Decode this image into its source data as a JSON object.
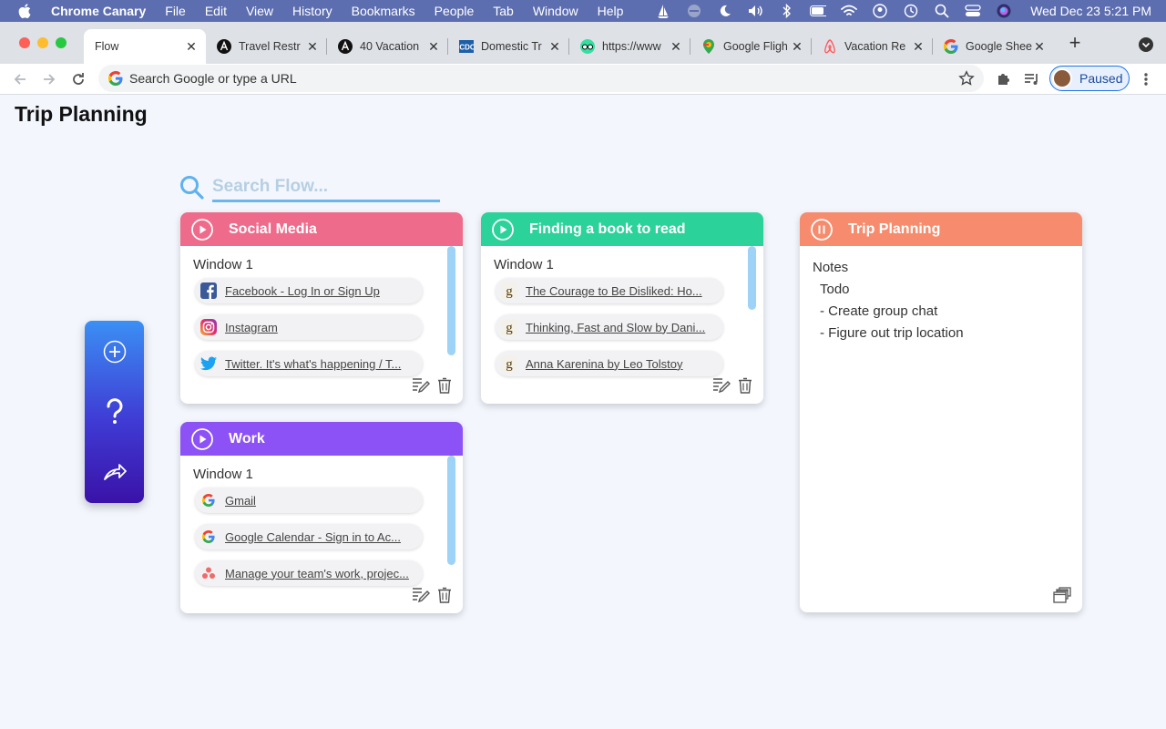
{
  "menubar": {
    "app_name": "Chrome Canary",
    "items": [
      "File",
      "Edit",
      "View",
      "History",
      "Bookmarks",
      "People",
      "Tab",
      "Window",
      "Help"
    ],
    "clock": "Wed Dec 23  5:21 PM"
  },
  "tabs": [
    {
      "title": "Flow",
      "icon": "flow-icon",
      "active": true
    },
    {
      "title": "Travel Restr",
      "icon": "letter-a-icon"
    },
    {
      "title": "40 Vacation",
      "icon": "letter-a-icon"
    },
    {
      "title": "Domestic Tr",
      "icon": "cdc-icon"
    },
    {
      "title": "https://www",
      "icon": "tripadvisor-icon"
    },
    {
      "title": "Google Fligh",
      "icon": "google-flights-icon"
    },
    {
      "title": "Vacation Re",
      "icon": "airbnb-icon"
    },
    {
      "title": "Google Shee",
      "icon": "google-icon"
    }
  ],
  "toolbar": {
    "omnibox_placeholder": "Search Google or type a URL",
    "profile_status": "Paused"
  },
  "page": {
    "title": "Trip Planning",
    "search_placeholder": "Search Flow..."
  },
  "cards": {
    "social": {
      "title": "Social Media",
      "color": "#ef6b8b",
      "window_label": "Window 1",
      "links": [
        {
          "text": "Facebook - Log In or Sign Up",
          "icon": "facebook-icon"
        },
        {
          "text": "Instagram",
          "icon": "instagram-icon"
        },
        {
          "text": "Twitter. It's what's happening / T...",
          "icon": "twitter-icon"
        }
      ]
    },
    "book": {
      "title": "Finding a book to read",
      "color": "#2bd29a",
      "window_label": "Window 1",
      "links": [
        {
          "text": "The Courage to Be Disliked: Ho...",
          "icon": "goodreads-icon"
        },
        {
          "text": "Thinking, Fast and Slow by Dani...",
          "icon": "goodreads-icon"
        },
        {
          "text": "Anna Karenina by Leo Tolstoy",
          "icon": "goodreads-icon"
        }
      ]
    },
    "work": {
      "title": "Work",
      "color": "#8c52f5",
      "window_label": "Window 1",
      "links": [
        {
          "text": "Gmail",
          "icon": "google-icon"
        },
        {
          "text": "Google Calendar - Sign in to Ac...",
          "icon": "google-icon"
        },
        {
          "text": "Manage your team's work, projec...",
          "icon": "asana-icon"
        }
      ]
    },
    "trip": {
      "title": "Trip Planning",
      "color": "#f68c6d",
      "notes_label": "Notes",
      "notes_lines": [
        "Todo",
        "- Create group chat",
        "- Figure out trip location"
      ]
    }
  }
}
